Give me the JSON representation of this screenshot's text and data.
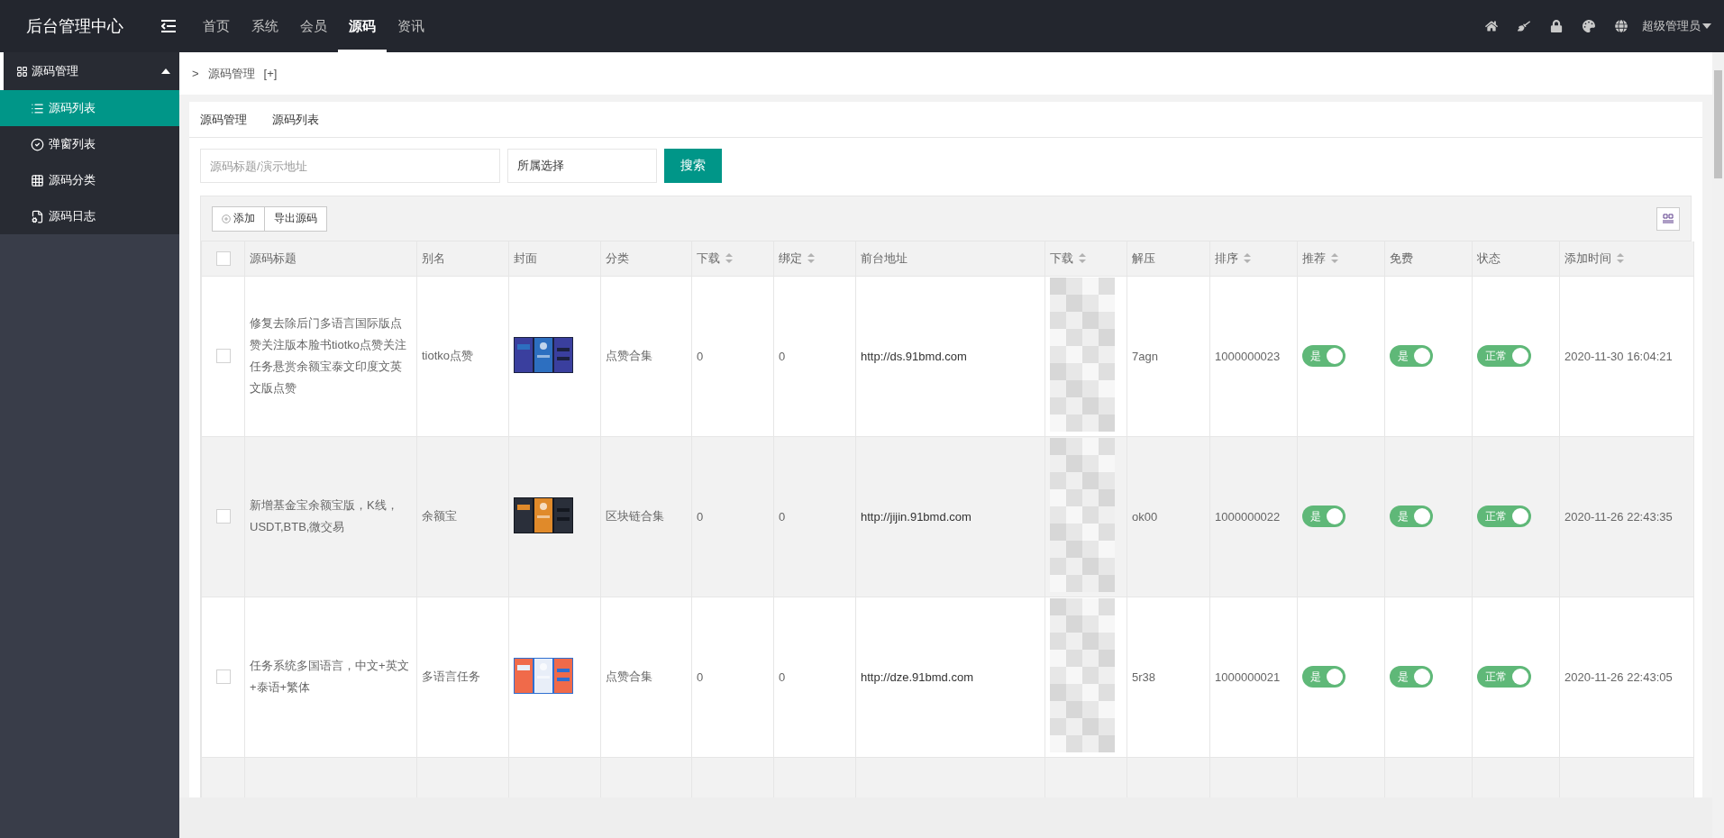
{
  "app": {
    "title": "后台管理中心"
  },
  "top_nav": [
    {
      "label": "首页",
      "selected": false
    },
    {
      "label": "系统",
      "selected": false
    },
    {
      "label": "会员",
      "selected": false
    },
    {
      "label": "源码",
      "selected": true
    },
    {
      "label": "资讯",
      "selected": false
    }
  ],
  "user": {
    "name": "超级管理员"
  },
  "sidebar": {
    "items": [
      {
        "label": "源码管理",
        "expanded": true,
        "children": [
          {
            "label": "源码列表",
            "selected": true
          },
          {
            "label": "弹窗列表",
            "selected": false
          },
          {
            "label": "源码分类",
            "selected": false
          },
          {
            "label": "源码日志",
            "selected": false
          }
        ]
      }
    ]
  },
  "breadcrumb": {
    "arrow": ">",
    "label": "源码管理",
    "action": "[+]"
  },
  "tabs": [
    {
      "label": "源码管理"
    },
    {
      "label": "源码列表"
    }
  ],
  "search": {
    "placeholder": "源码标题/演示地址",
    "select": "所属选择",
    "button": "搜索"
  },
  "toolbar": {
    "buttons": [
      "添加",
      "导出源码"
    ]
  },
  "table": {
    "select_all_checked": false,
    "columns": [
      {
        "label": "源码标题",
        "sortable": false
      },
      {
        "label": "别名",
        "sortable": false
      },
      {
        "label": "封面",
        "sortable": false
      },
      {
        "label": "分类",
        "sortable": false
      },
      {
        "label": "下载",
        "sortable": true
      },
      {
        "label": "绑定",
        "sortable": true
      },
      {
        "label": "前台地址",
        "sortable": false
      },
      {
        "label": "下载",
        "sortable": true
      },
      {
        "label": "解压",
        "sortable": false
      },
      {
        "label": "排序",
        "sortable": true
      },
      {
        "label": "推荐",
        "sortable": true
      },
      {
        "label": "免费",
        "sortable": false
      },
      {
        "label": "状态",
        "sortable": false
      },
      {
        "label": "添加时间",
        "sortable": true
      }
    ],
    "rows": [
      {
        "checked": false,
        "title": "修复去除后门多语言国际版点赞关注版本脸书tiotko点赞关注任务悬赏余额宝泰文印度文英文版点赞",
        "alias": "tiotko点赞",
        "category": "点赞合集",
        "downloads": "0",
        "bound": "0",
        "url": "http://ds.91bmd.com",
        "unzip": "7agn",
        "sort": "1000000023",
        "recommend": {
          "label": "是",
          "on": true
        },
        "free": {
          "label": "是",
          "on": true
        },
        "status": {
          "label": "正常",
          "on": true
        },
        "added": "2020-11-30 16:04:21"
      },
      {
        "checked": false,
        "title": "新增基金宝余额宝版，K线，USDT,BTB,微交易",
        "alias": "余额宝",
        "category": "区块链合集",
        "downloads": "0",
        "bound": "0",
        "url": "http://jijin.91bmd.com",
        "unzip": "ok00",
        "sort": "1000000022",
        "recommend": {
          "label": "是",
          "on": true
        },
        "free": {
          "label": "是",
          "on": true
        },
        "status": {
          "label": "正常",
          "on": true
        },
        "added": "2020-11-26 22:43:35"
      },
      {
        "checked": false,
        "title": "任务系统多国语言，中文+英文+泰语+繁体",
        "alias": "多语言任务",
        "category": "点赞合集",
        "downloads": "0",
        "bound": "0",
        "url": "http://dze.91bmd.com",
        "unzip": "5r38",
        "sort": "1000000021",
        "recommend": {
          "label": "是",
          "on": true
        },
        "free": {
          "label": "是",
          "on": true
        },
        "status": {
          "label": "正常",
          "on": true
        },
        "added": "2020-11-26 22:43:05"
      }
    ]
  }
}
